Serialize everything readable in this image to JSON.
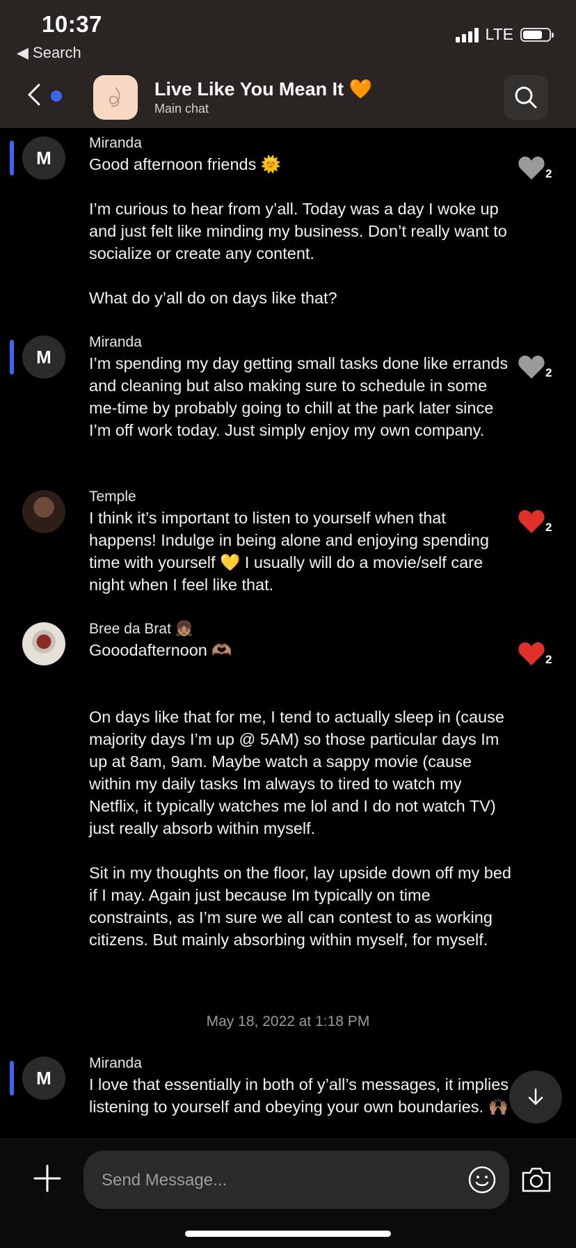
{
  "status_bar": {
    "time": "10:37",
    "back_label": "◀ Search",
    "network": "LTE",
    "battery_level": 0.75
  },
  "header": {
    "title": "Live Like You Mean It 🧡",
    "subtitle": "Main chat"
  },
  "messages": [
    {
      "sender": "Miranda",
      "avatar": "M",
      "text": "Good afternoon friends 🌞\n\nI’m curious to hear from y’all. Today was a day I woke up and just felt like minding my business. Don’t really want to socialize or create any content.\n\nWhat do y’all do on days like that?",
      "likes": "2",
      "liked": false
    },
    {
      "sender": "Miranda",
      "avatar": "M",
      "text": "I’m spending my day getting small tasks done like errands and cleaning but also making sure to schedule in some me-time by probably going to chill at the park later since I’m off work today. Just simply enjoy my own company.",
      "likes": "2",
      "liked": false
    },
    {
      "sender": "Temple",
      "text": "I think it’s important to listen to yourself when that happens! Indulge in being alone and enjoying spending time with yourself 💛 I usually will do a movie/self care night when I feel like that.",
      "likes": "2",
      "liked": true
    },
    {
      "sender": "Bree da Brat 👧🏽",
      "text": "Gooodafternoon 🫶🏽\n\n\nOn days like that for me, I tend to actually sleep in (cause majority days I’m up @ 5AM) so those particular days Im up at 8am, 9am. Maybe watch a sappy movie (cause within my daily tasks Im always to tired to watch my Netflix, it typically watches me lol and I do not watch TV) just really absorb within myself.\n\nSit in my thoughts on the floor, lay upside down off my bed if I may. Again just because Im typically on time constraints, as I’m sure we all can contest to as working citizens. But mainly absorbing within myself, for myself.",
      "likes": "2",
      "liked": true
    },
    {
      "sender": "Miranda",
      "avatar": "M",
      "text": "I love that essentially in both of y’all’s messages, it implies listening to yourself and obeying your own boundaries. 🙌🏽"
    }
  ],
  "timestamp": "May 18, 2022 at 1:18 PM",
  "composer": {
    "placeholder": "Send Message..."
  },
  "colors": {
    "accent": "#3a67f2",
    "like_red": "#e0302a",
    "like_gray": "#9a9a9a"
  }
}
